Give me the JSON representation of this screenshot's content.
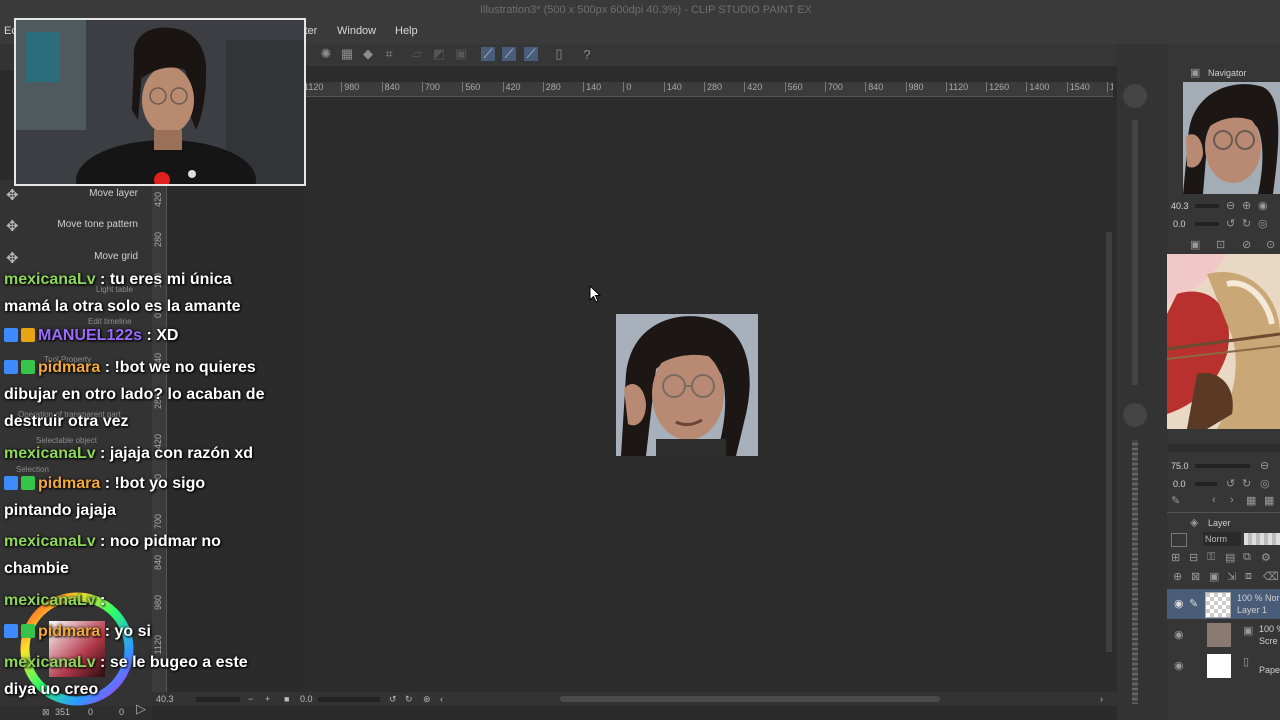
{
  "window": {
    "title": "Illustration3* (500 x 500px 600dpi 40.3%) - CLIP STUDIO PAINT EX",
    "menu_partial": "Ec",
    "menu_filter_partial": "lter",
    "menu_window": "Window",
    "menu_help": "Help"
  },
  "ruler_top": [
    "1120",
    "980",
    "840",
    "700",
    "560",
    "420",
    "280",
    "140",
    "0",
    "140",
    "280",
    "420",
    "560",
    "700",
    "840",
    "980",
    "1120",
    "1260",
    "1400",
    "1540",
    "16"
  ],
  "ruler_left": [
    "420",
    "280",
    "140",
    "0",
    "140",
    "280",
    "420",
    "560",
    "700",
    "840",
    "980",
    "1120"
  ],
  "tools": {
    "move_layer": "Move layer",
    "move_tone_pattern": "Move tone pattern",
    "move_grid": "Move grid"
  },
  "ghost_labels": {
    "light_table": "Light table",
    "edit_timeline": "Edit timeline",
    "tool_property": "Tool Property",
    "transparent_part": "Operation of transparent part",
    "selectable_object": "Selectable object",
    "selection": "Selection"
  },
  "chat": [
    {
      "user": "mexicanaLv",
      "color": "#8ed65a",
      "badges": [],
      "lines": [
        ": tu eres mi única",
        "mamá la otra solo es la amante"
      ]
    },
    {
      "user": "MANUEL122s",
      "color": "#9b6bff",
      "badges": [
        "blue",
        "gold"
      ],
      "lines": [
        ": XD"
      ]
    },
    {
      "user": "pidmara",
      "color": "#f3a93a",
      "badges": [
        "blue",
        "green"
      ],
      "lines": [
        ": !bot we no quieres",
        "dibujar en otro lado? lo acaban de",
        "destruir otra vez"
      ]
    },
    {
      "user": "mexicanaLv",
      "color": "#8ed65a",
      "badges": [],
      "lines": [
        ": jajaja con razón xd"
      ]
    },
    {
      "user": "pidmara",
      "color": "#f3a93a",
      "badges": [
        "blue",
        "green"
      ],
      "lines": [
        ": !bot yo sigo",
        "pintando jajaja"
      ]
    },
    {
      "user": "mexicanaLv",
      "color": "#8ed65a",
      "badges": [],
      "lines": [
        ": noo pidmar no",
        "chambie"
      ]
    },
    {
      "user": "mexicanaLv",
      "color": "#8ed65a",
      "badges": [],
      "lines": [
        ":"
      ]
    },
    {
      "user": "pidmara",
      "color": "#f3a93a",
      "badges": [
        "blue",
        "green"
      ],
      "lines": [
        ": yo si"
      ]
    },
    {
      "user": "mexicanaLv",
      "color": "#8ed65a",
      "badges": [],
      "lines": [
        ": se le bugeo a este",
        "diya uo creo"
      ]
    }
  ],
  "navigator": {
    "label": "Navigator",
    "zoom": "40.3",
    "angle": "0.0"
  },
  "subview": {
    "zoom": "75.0",
    "angle": "0.0"
  },
  "layer_panel": {
    "label": "Layer",
    "blend_mode": "Norm",
    "layers": [
      {
        "name": "Layer 1",
        "opacity": "100 % Nor",
        "selected": true
      },
      {
        "name": "Scre",
        "opacity": "100 %",
        "selected": false
      },
      {
        "name": "Pape",
        "opacity": "",
        "selected": false
      }
    ]
  },
  "statusbar": {
    "zoom": "40.3",
    "angle": "0.0",
    "left_counts": "351",
    "left_zero1": "0",
    "left_zero2": "0"
  },
  "colors": {
    "accent_blue": "#4a5d78",
    "chat_green": "#8ed65a",
    "chat_purple": "#9b6bff",
    "chat_orange": "#f3a93a"
  }
}
